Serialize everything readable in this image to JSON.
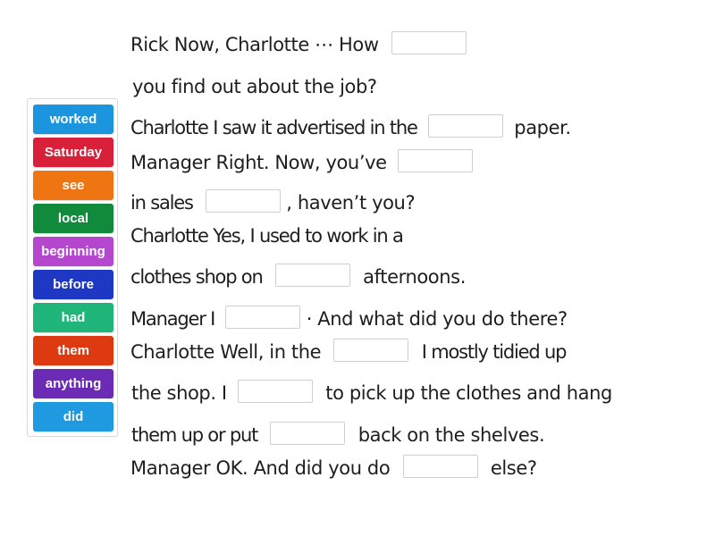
{
  "word_bank": [
    {
      "label": "worked",
      "color": "#1b96de"
    },
    {
      "label": "Saturday",
      "color": "#d8203a"
    },
    {
      "label": "see",
      "color": "#ef7512"
    },
    {
      "label": "local",
      "color": "#118a3c"
    },
    {
      "label": "beginning",
      "color": "#b547cf"
    },
    {
      "label": "before",
      "color": "#1f38c4"
    },
    {
      "label": "had",
      "color": "#1fb57b"
    },
    {
      "label": "them",
      "color": "#de3a12"
    },
    {
      "label": "anything",
      "color": "#6c2bb4"
    },
    {
      "label": "did",
      "color": "#1f9ae0"
    }
  ],
  "lines": {
    "l1": {
      "a": "Rick Now, Charlotte ⋯ How"
    },
    "l2": {
      "a": "you find out about the job?"
    },
    "l3": {
      "a": "Charlotte I saw it advertised in the",
      "b": "paper."
    },
    "l4": {
      "a": "Manager Right. Now, you’ve"
    },
    "l5": {
      "a": "in sales",
      "b": ", haven’t you?"
    },
    "l6": {
      "a": "Charlotte Yes, I used to work in a"
    },
    "l7": {
      "a": "clothes shop on",
      "b": "afternoons."
    },
    "l8": {
      "a": "Manager I",
      "b": "· And what did you do there?"
    },
    "l9": {
      "a": "Charlotte Well, in the",
      "b": "I mostly tidied up"
    },
    "l10": {
      "a": "the shop. I",
      "b": "to pick up the clothes and hang"
    },
    "l11": {
      "a": "them up or put",
      "b": "back on the shelves."
    },
    "l12": {
      "a": "Manager OK. And did you do",
      "b": "else?"
    }
  }
}
